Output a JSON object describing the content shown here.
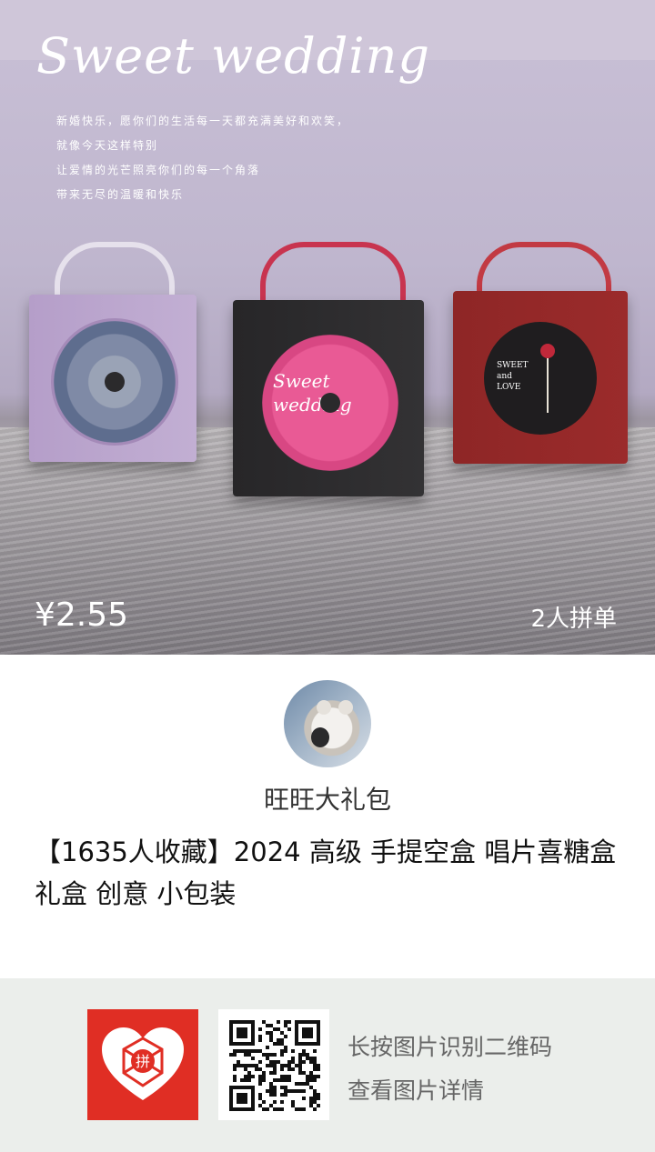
{
  "hero": {
    "script_title": "Sweet wedding",
    "poem_lines": [
      "新婚快乐，愿你们的生活每一天都充满美好和欢笑，",
      "就像今天这样特别",
      "让爱情的光芒照亮你们的每一个角落",
      "带来无尽的温暖和快乐"
    ],
    "disc_text": "Sweet wedding",
    "disc_text_right": "SWEET and LOVE",
    "price": "¥2.55",
    "group_buy": "2人拼单"
  },
  "shop": {
    "name": "旺旺大礼包",
    "avatar_icon": "cat-avatar-icon"
  },
  "product": {
    "title": "【1635人收藏】2024 高级 手提空盒 唱片喜糖盒礼盒 创意 小包装"
  },
  "footer": {
    "logo_text": "拼",
    "line1": "长按图片识别二维码",
    "line2": "查看图片详情"
  },
  "colors": {
    "brand_red": "#e02e24",
    "footer_bg": "#ebeeeb"
  }
}
